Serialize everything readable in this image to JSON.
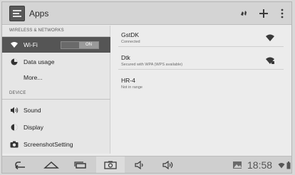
{
  "actionbar": {
    "title": "Apps",
    "icons": [
      "apps-icon",
      "refresh-icon",
      "add-icon",
      "overflow-menu-icon"
    ]
  },
  "sidebar": {
    "sections": [
      {
        "header": "WIRELESS & NETWORKS"
      },
      {
        "header": "DEVICE"
      }
    ],
    "items": [
      {
        "label": "Wi-Fi",
        "icon": "wifi-icon",
        "selected": true,
        "toggle": "ON"
      },
      {
        "label": "Data usage",
        "icon": "data-usage-icon"
      },
      {
        "label": "More..."
      },
      {
        "label": "Sound",
        "icon": "speaker-icon"
      },
      {
        "label": "Display",
        "icon": "display-icon"
      },
      {
        "label": "ScreenshotSetting",
        "icon": "camera-icon"
      }
    ]
  },
  "networks": [
    {
      "ssid": "GstDK",
      "status": "Connected",
      "icon": "wifi-signal-icon"
    },
    {
      "ssid": "Dtk",
      "status": "Secured with WPA (WPS available)",
      "icon": "wifi-signal-locked-icon"
    },
    {
      "ssid": "HR-4",
      "status": "Not in range"
    }
  ],
  "navbar": {
    "clock": "18:58",
    "icons": [
      "back-icon",
      "home-icon",
      "recent-apps-icon",
      "screenshot-icon",
      "volume-down-icon",
      "volume-up-icon",
      "gallery-icon",
      "wifi-status-icon",
      "battery-icon"
    ]
  },
  "colors": {
    "selected_bg": "#555555",
    "background": "#ececec",
    "navbar_bg": "#cfcfcf"
  }
}
